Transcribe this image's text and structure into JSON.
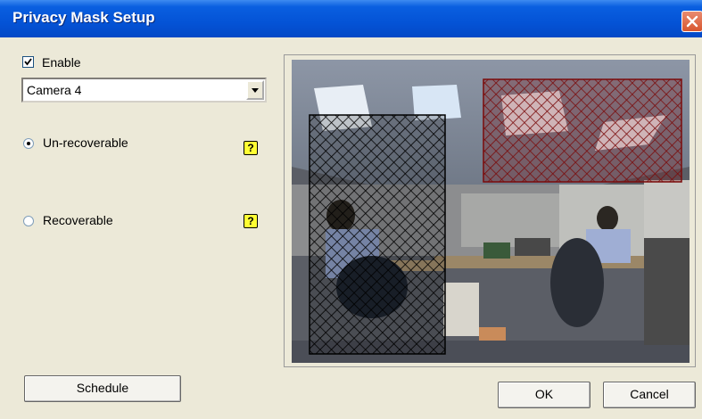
{
  "window": {
    "title": "Privacy Mask Setup"
  },
  "enable": {
    "label": "Enable",
    "checked": true
  },
  "camera_select": {
    "value": "Camera 4"
  },
  "mode": {
    "unrecoverable_label": "Un-recoverable",
    "recoverable_label": "Recoverable",
    "selected": "Un-recoverable",
    "help_glyph": "?"
  },
  "buttons": {
    "schedule": "Schedule",
    "ok": "OK",
    "cancel": "Cancel"
  },
  "mask_regions": [
    {
      "name": "dark-mask",
      "color": "#111111"
    },
    {
      "name": "red-mask",
      "color": "#8b1010"
    }
  ]
}
